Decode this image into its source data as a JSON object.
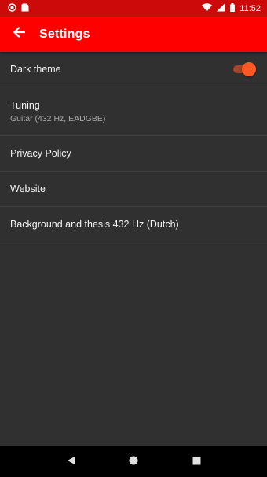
{
  "status_bar": {
    "time": "11:52",
    "icons": [
      "notification-dot-icon",
      "sim-card-icon",
      "wifi-icon",
      "signal-icon",
      "battery-icon"
    ]
  },
  "app_bar": {
    "title": "Settings",
    "back_icon": "arrow-left-icon",
    "background": "#ff0000"
  },
  "settings": {
    "dark_theme": {
      "title": "Dark theme",
      "enabled": true,
      "accent": "#ff5722"
    },
    "tuning": {
      "title": "Tuning",
      "summary": "Guitar (432 Hz, EADGBE)"
    },
    "privacy_policy": {
      "title": "Privacy Policy"
    },
    "website": {
      "title": "Website"
    },
    "background": {
      "title": "Background and thesis 432 Hz (Dutch)"
    }
  },
  "nav_bar": {
    "back_icon": "triangle-back-icon",
    "home_icon": "circle-home-icon",
    "recents_icon": "square-recents-icon"
  }
}
